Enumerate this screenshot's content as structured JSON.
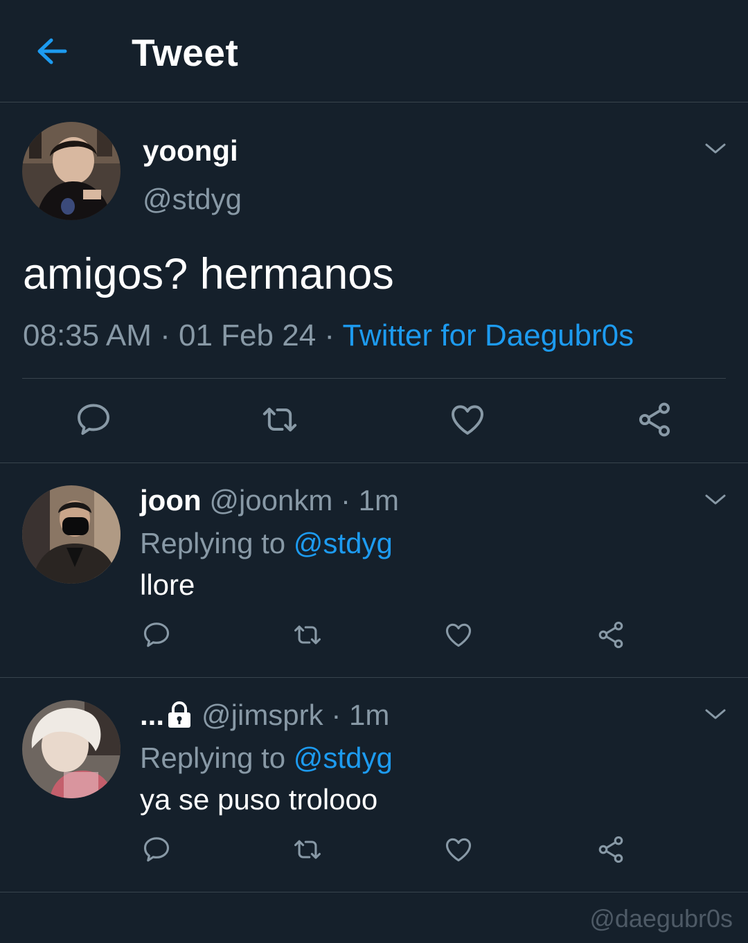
{
  "header": {
    "title": "Tweet",
    "back_icon": "arrow-left-icon"
  },
  "colors": {
    "background": "#15202b",
    "accent": "#1d9bf0",
    "muted": "#8899a6",
    "divider": "#38444d"
  },
  "tweet": {
    "name": "yoongi",
    "handle": "@stdyg",
    "text": "amigos? hermanos",
    "time": "08:35 AM",
    "sep": " · ",
    "date": "01 Feb 24",
    "source": "Twitter for Daegubr0s",
    "actions": [
      "reply-icon",
      "retweet-icon",
      "like-icon",
      "share-icon"
    ]
  },
  "replies": [
    {
      "name": "joon",
      "handle": "@joonkm",
      "time": "· 1m",
      "replying_label": "Replying to",
      "mention": "@stdyg",
      "text": "llore"
    },
    {
      "name": "...",
      "handle": "@jimsprk",
      "time": "· 1m",
      "replying_label": "Replying to",
      "mention": "@stdyg",
      "text": "ya se puso trolooo"
    }
  ],
  "watermark": "@daegubr0s"
}
